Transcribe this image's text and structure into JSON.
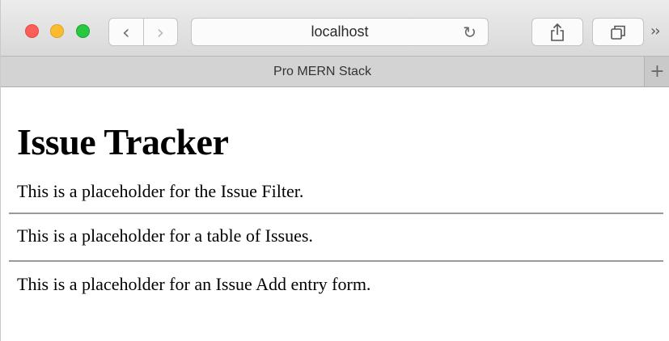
{
  "browser": {
    "address": "localhost",
    "tab_title": "Pro MERN Stack",
    "icons": {
      "back": "chevron-left-icon",
      "forward": "chevron-right-icon",
      "reload": "reload-icon",
      "share": "share-icon",
      "tabs": "tabs-overview-icon",
      "overflow": "chevron-double-right-icon",
      "new_tab": "plus-icon"
    },
    "colors": {
      "close": "#fc5f57",
      "minimize": "#fdbc2e",
      "maximize": "#28c840"
    }
  },
  "page": {
    "title": "Issue Tracker",
    "issue_filter": "This is a placeholder for the Issue Filter.",
    "issue_table": "This is a placeholder for a table of Issues.",
    "issue_add": "This is a placeholder for an Issue Add entry form."
  }
}
